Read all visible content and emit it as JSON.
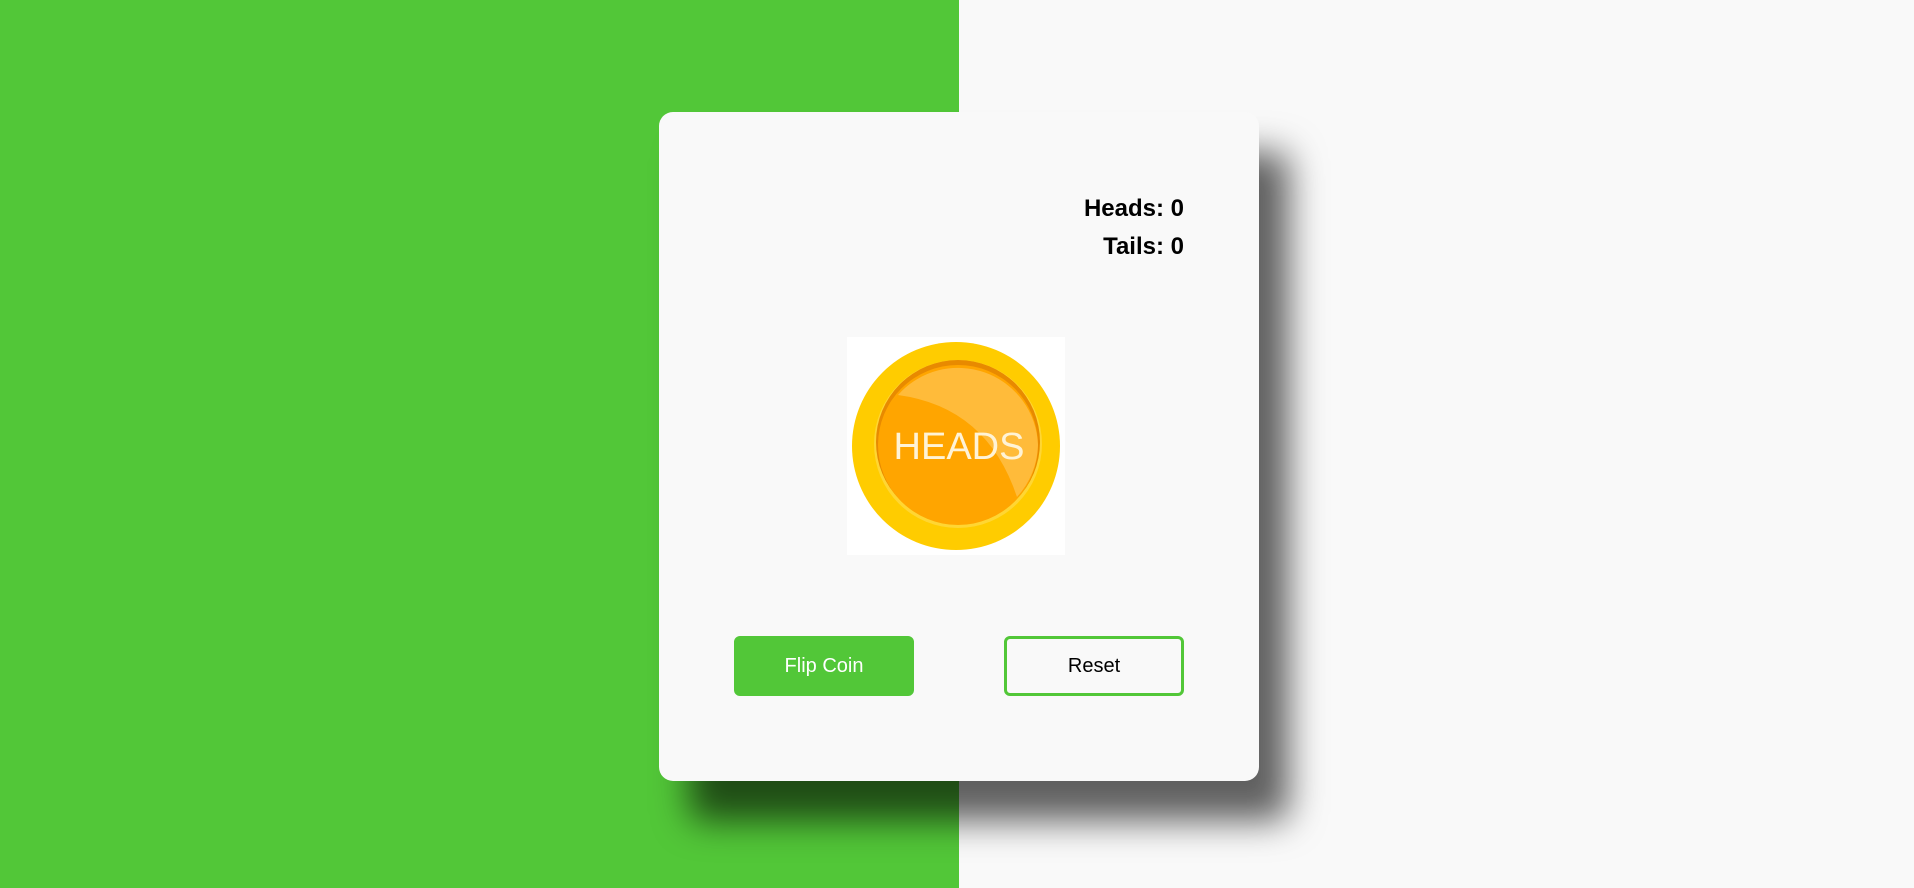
{
  "colors": {
    "accent": "#52c738",
    "background_right": "#f9f9f9",
    "coin_outer": "#ffcc00",
    "coin_inner": "#ffa500"
  },
  "stats": {
    "heads_label": "Heads: 0",
    "tails_label": "Tails: 0"
  },
  "coin": {
    "face_text": "HEADS",
    "icon": "coin-heads-icon"
  },
  "buttons": {
    "flip_label": "Flip Coin",
    "reset_label": "Reset"
  }
}
